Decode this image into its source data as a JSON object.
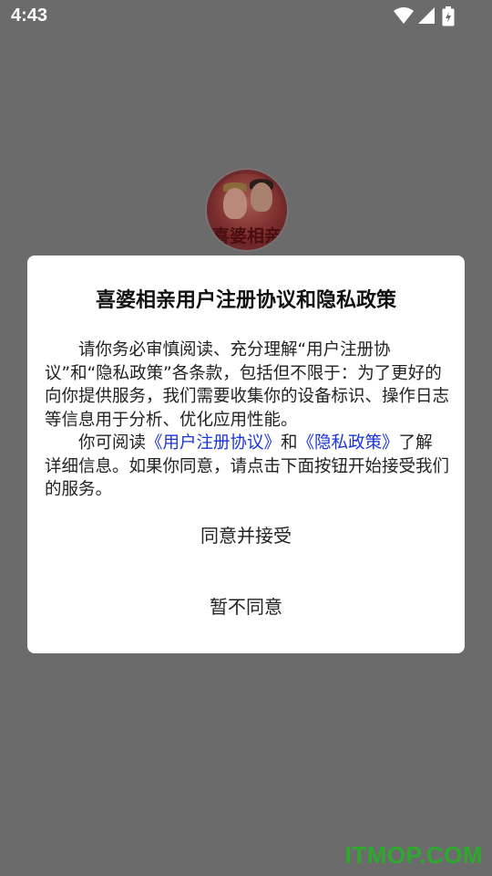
{
  "status_bar": {
    "time": "4:43",
    "icons": [
      "wifi-icon",
      "cell-signal-icon",
      "battery-charging-icon"
    ]
  },
  "app": {
    "avatar_text": "喜婆相亲"
  },
  "dialog": {
    "title": "喜婆相亲用户注册协议和隐私政策",
    "paragraph1": "请你务必审慎阅读、充分理解“用户注册协议”和“隐私政策”各条款，包括但不限于：为了更好的向你提供服务，我们需要收集你的设备标识、操作日志等信息用于分析、优化应用性能。",
    "paragraph2_prefix": "你可阅读",
    "link_user_agreement": "《用户注册协议》",
    "paragraph2_and": "和",
    "link_privacy_policy": "《隐私政策》",
    "paragraph2_suffix": "了解详细信息。如果你同意，请点击下面按钮开始接受我们的服务。",
    "agree_label": "同意并接受",
    "decline_label": "暂不同意"
  },
  "watermark": "ITMOP.COM",
  "colors": {
    "overlay": "#6b6b6b",
    "link": "#1a35d6",
    "dialog_bg": "#ffffff",
    "watermark": "#2fa82f"
  }
}
